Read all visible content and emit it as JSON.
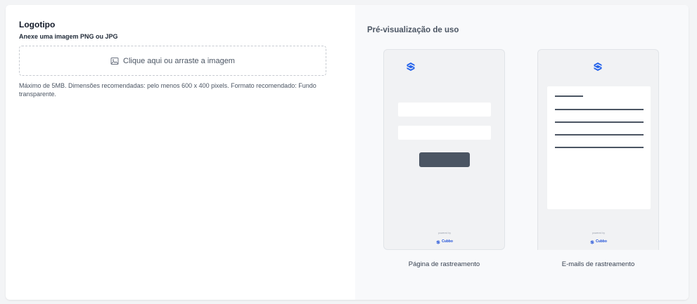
{
  "logo_section": {
    "title": "Logotipo",
    "subtitle": "Anexe uma imagem PNG ou JPG",
    "dropzone_label": "Clique aqui ou arraste a imagem",
    "help_text": "Máximo de 5MB. Dimensões recomendadas: pelo menos 600 x 400 pixels. Formato recomendado: Fundo transparente."
  },
  "preview": {
    "title": "Pré-visualização de uso",
    "tracking_page_caption": "Página de rastreamento",
    "tracking_email_caption": "E-mails de rastreamento",
    "powered_by": "powered by",
    "brand_name": "Cubbo"
  },
  "colors": {
    "brand": "#2563eb",
    "mock_button": "#4b5563",
    "mock_bg": "#f1f2f4"
  },
  "icons": {
    "image_icon": "image-icon",
    "brand_logo": "cubbo-logo-icon"
  }
}
